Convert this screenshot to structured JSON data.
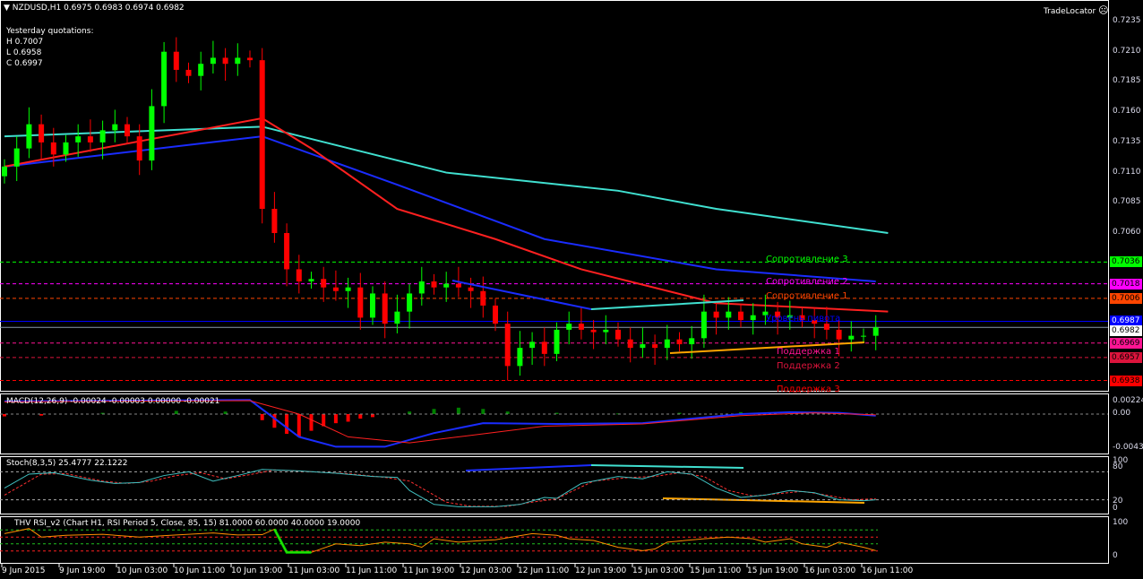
{
  "header": {
    "symbol": "NZDUSD,H1",
    "ohlc": "0.6975 0.6983 0.6974 0.6982",
    "yesterday_title": "Yesterday quotations:",
    "high": "H 0.7007",
    "low": "L 0.6958",
    "close": "C 0.6997",
    "brand": "TradeLocator"
  },
  "chart_data": {
    "type": "candlestick",
    "title": "NZDUSD,H1",
    "ylim": [
      0.6925,
      0.7245
    ],
    "price_ticks": [
      "0.7235",
      "0.7210",
      "0.7185",
      "0.7160",
      "0.7135",
      "0.7110",
      "0.7085",
      "0.7060"
    ],
    "closes": [
      0.7115,
      0.713,
      0.715,
      0.7135,
      0.7125,
      0.7135,
      0.714,
      0.7135,
      0.7145,
      0.715,
      0.714,
      0.712,
      0.7165,
      0.721,
      0.7195,
      0.719,
      0.72,
      0.7205,
      0.72,
      0.7205,
      0.7203,
      0.708,
      0.706,
      0.703,
      0.702,
      0.7022,
      0.7015,
      0.7012,
      0.7015,
      0.699,
      0.701,
      0.6985,
      0.6995,
      0.701,
      0.702,
      0.7015,
      0.7018,
      0.7015,
      0.7012,
      0.7,
      0.6985,
      0.695,
      0.6965,
      0.697,
      0.696,
      0.698,
      0.6985,
      0.698,
      0.6978,
      0.698,
      0.6972,
      0.6965,
      0.6968,
      0.6965,
      0.6972,
      0.6968,
      0.6973,
      0.6995,
      0.699,
      0.6995,
      0.6988,
      0.6992,
      0.6995,
      0.699,
      0.6992,
      0.6988,
      0.6985,
      0.698,
      0.6972,
      0.6975,
      0.6975,
      0.6982
    ],
    "colors": {
      "up": "#00ff00",
      "down": "#ff0000"
    },
    "moving_averages": [
      {
        "name": "MA slow",
        "color": "#40e0d0",
        "points": [
          [
            0,
            0.714
          ],
          [
            21,
            0.7148
          ],
          [
            36,
            0.711
          ],
          [
            50,
            0.7095
          ],
          [
            58,
            0.708
          ],
          [
            72,
            0.706
          ]
        ]
      },
      {
        "name": "MA mid",
        "color": "#1a2cff",
        "points": [
          [
            0,
            0.7115
          ],
          [
            21,
            0.714
          ],
          [
            32,
            0.71
          ],
          [
            44,
            0.7055
          ],
          [
            58,
            0.703
          ],
          [
            71,
            0.702
          ]
        ]
      },
      {
        "name": "MA fast",
        "color": "#ff2020",
        "points": [
          [
            0,
            0.7115
          ],
          [
            21,
            0.7155
          ],
          [
            25,
            0.713
          ],
          [
            32,
            0.708
          ],
          [
            40,
            0.7055
          ],
          [
            47,
            0.703
          ],
          [
            58,
            0.7002
          ],
          [
            72,
            0.6995
          ]
        ]
      }
    ],
    "levels": [
      {
        "label": "Сопротивление 3",
        "value": "0.7036",
        "price": 0.7036,
        "color": "#00ff00",
        "text": "#000"
      },
      {
        "label": "Сопротивление 2",
        "value": "0.7018",
        "price": 0.7018,
        "color": "#ff00ff",
        "text": "#000"
      },
      {
        "label": "Сопротивление 1",
        "value": "0.7006",
        "price": 0.7006,
        "color": "#ff4500",
        "text": "#000"
      },
      {
        "label": "Уровень пивота",
        "value": "0.6987",
        "price": 0.6987,
        "color": "#0000ff",
        "text": "#fff"
      },
      {
        "label": "Поддержка 1",
        "value": "0.6969",
        "price": 0.6969,
        "color": "#ff1493",
        "text": "#000"
      },
      {
        "label": "Поддержка 2",
        "value": "0.6957",
        "price": 0.6957,
        "color": "#dc143c",
        "text": "#000"
      },
      {
        "label": "Поддержка 3",
        "value": "0.6938",
        "price": 0.6938,
        "color": "#ff0000",
        "text": "#000"
      }
    ],
    "current_price": {
      "value": "0.6982",
      "price": 0.6982
    },
    "macd": {
      "label": "MACD(12,26,9) -0.00024 -0.00003 0.00000 -0.00021",
      "ticks": [
        "0.00224",
        "0.00",
        "-0.00437"
      ],
      "ylim": [
        -0.00437,
        0.00224
      ],
      "main": [
        [
          0,
          0.002
        ],
        [
          20,
          0.0022
        ],
        [
          24,
          -0.003
        ],
        [
          27,
          -0.0043
        ],
        [
          31,
          -0.0043
        ],
        [
          35,
          -0.0025
        ],
        [
          39,
          -0.0012
        ],
        [
          45,
          -0.0013
        ],
        [
          52,
          -0.0012
        ],
        [
          60,
          0.0
        ],
        [
          64,
          0.0003
        ],
        [
          68,
          0.0002
        ],
        [
          71,
          -0.0002
        ]
      ],
      "signal": [
        [
          0,
          0.0019
        ],
        [
          20,
          0.0021
        ],
        [
          24,
          0.0
        ],
        [
          28,
          -0.003
        ],
        [
          33,
          -0.0038
        ],
        [
          38,
          -0.0028
        ],
        [
          44,
          -0.0016
        ],
        [
          52,
          -0.0013
        ],
        [
          60,
          -0.0002
        ],
        [
          66,
          0.0002
        ],
        [
          71,
          -0.0001
        ]
      ],
      "hist": [
        [
          0,
          -0.0003
        ],
        [
          3,
          -0.0002
        ],
        [
          8,
          0.0002
        ],
        [
          14,
          0.0005
        ],
        [
          18,
          0.0004
        ],
        [
          21,
          -0.0008
        ],
        [
          22,
          -0.0018
        ],
        [
          23,
          -0.0026
        ],
        [
          24,
          -0.003
        ],
        [
          25,
          -0.0022
        ],
        [
          26,
          -0.0016
        ],
        [
          27,
          -0.0012
        ],
        [
          28,
          -0.001
        ],
        [
          29,
          -0.0006
        ],
        [
          30,
          -0.0004
        ],
        [
          33,
          0.0004
        ],
        [
          35,
          0.0008
        ],
        [
          37,
          0.001
        ],
        [
          39,
          0.0008
        ],
        [
          41,
          0.0004
        ],
        [
          45,
          0.0002
        ],
        [
          50,
          0.0001
        ],
        [
          55,
          0.0002
        ],
        [
          60,
          0.0003
        ],
        [
          64,
          0.0002
        ],
        [
          68,
          0.0001
        ]
      ]
    },
    "stoch": {
      "label": "Stoch(8,3,5) 25.4777 22.1222",
      "ticks": [
        "100",
        "80",
        "20",
        "0"
      ],
      "k": [
        [
          0,
          45
        ],
        [
          2,
          75
        ],
        [
          4,
          78
        ],
        [
          7,
          62
        ],
        [
          9,
          55
        ],
        [
          11,
          57
        ],
        [
          13,
          72
        ],
        [
          15,
          80
        ],
        [
          17,
          60
        ],
        [
          19,
          72
        ],
        [
          21,
          85
        ],
        [
          24,
          82
        ],
        [
          27,
          77
        ],
        [
          30,
          70
        ],
        [
          32,
          68
        ],
        [
          33,
          40
        ],
        [
          35,
          10
        ],
        [
          37,
          5
        ],
        [
          40,
          5
        ],
        [
          42,
          10
        ],
        [
          44,
          25
        ],
        [
          45,
          23
        ],
        [
          47,
          55
        ],
        [
          50,
          70
        ],
        [
          52,
          65
        ],
        [
          54,
          80
        ],
        [
          56,
          75
        ],
        [
          58,
          45
        ],
        [
          60,
          25
        ],
        [
          62,
          30
        ],
        [
          64,
          40
        ],
        [
          66,
          35
        ],
        [
          68,
          20
        ],
        [
          70,
          18
        ],
        [
          71,
          20
        ]
      ],
      "d": [
        [
          0,
          30
        ],
        [
          3,
          75
        ],
        [
          5,
          76
        ],
        [
          8,
          60
        ],
        [
          10,
          55
        ],
        [
          12,
          60
        ],
        [
          14,
          72
        ],
        [
          16,
          78
        ],
        [
          18,
          65
        ],
        [
          20,
          74
        ],
        [
          22,
          84
        ],
        [
          25,
          80
        ],
        [
          28,
          76
        ],
        [
          31,
          68
        ],
        [
          33,
          60
        ],
        [
          34,
          45
        ],
        [
          36,
          15
        ],
        [
          38,
          6
        ],
        [
          41,
          6
        ],
        [
          43,
          15
        ],
        [
          45,
          22
        ],
        [
          46,
          35
        ],
        [
          48,
          60
        ],
        [
          51,
          68
        ],
        [
          53,
          70
        ],
        [
          55,
          78
        ],
        [
          57,
          70
        ],
        [
          59,
          40
        ],
        [
          61,
          28
        ],
        [
          63,
          33
        ],
        [
          65,
          38
        ],
        [
          67,
          30
        ],
        [
          69,
          20
        ],
        [
          71,
          22
        ]
      ]
    },
    "rsi": {
      "label": "THV RSI_v2   (Chart H1,  RSI Period 5,  Close,  85,  15)  81.0000 60.0000 40.0000 19.0000",
      "ticks": [
        "100",
        "0"
      ],
      "levels": [
        81,
        60,
        40,
        19
      ],
      "values": [
        [
          0,
          70
        ],
        [
          2,
          85
        ],
        [
          3,
          60
        ],
        [
          5,
          65
        ],
        [
          8,
          68
        ],
        [
          11,
          60
        ],
        [
          14,
          66
        ],
        [
          17,
          72
        ],
        [
          19,
          66
        ],
        [
          21,
          67
        ],
        [
          22,
          83
        ],
        [
          23,
          15
        ],
        [
          25,
          15
        ],
        [
          27,
          40
        ],
        [
          29,
          35
        ],
        [
          31,
          45
        ],
        [
          33,
          40
        ],
        [
          34,
          30
        ],
        [
          35,
          55
        ],
        [
          37,
          45
        ],
        [
          39,
          50
        ],
        [
          40,
          52
        ],
        [
          43,
          70
        ],
        [
          45,
          65
        ],
        [
          46,
          55
        ],
        [
          48,
          50
        ],
        [
          50,
          30
        ],
        [
          52,
          20
        ],
        [
          53,
          25
        ],
        [
          54,
          45
        ],
        [
          57,
          55
        ],
        [
          59,
          60
        ],
        [
          61,
          55
        ],
        [
          62,
          45
        ],
        [
          64,
          55
        ],
        [
          65,
          40
        ],
        [
          67,
          30
        ],
        [
          68,
          45
        ],
        [
          70,
          30
        ],
        [
          71,
          20
        ]
      ]
    },
    "time_labels": [
      "9 Jun 2015",
      "9 Jun 19:00",
      "10 Jun 03:00",
      "10 Jun 11:00",
      "10 Jun 19:00",
      "11 Jun 03:00",
      "11 Jun 11:00",
      "11 Jun 19:00",
      "12 Jun 03:00",
      "12 Jun 11:00",
      "12 Jun 19:00",
      "15 Jun 03:00",
      "15 Jun 11:00",
      "15 Jun 19:00",
      "16 Jun 03:00",
      "16 Jun 11:00"
    ]
  }
}
